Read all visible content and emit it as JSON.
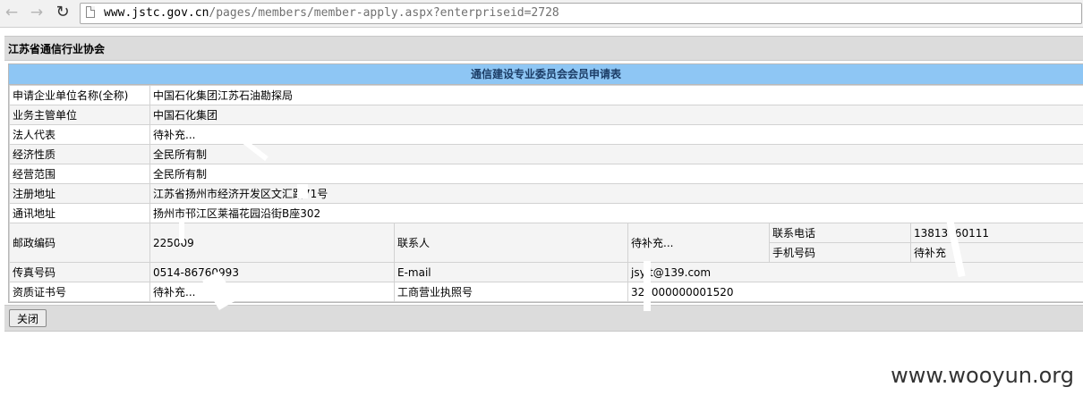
{
  "browser": {
    "url_host": "www.jstc.gov.cn",
    "url_path": "/pages/members/member-apply.aspx?enterpriseid=2728"
  },
  "page": {
    "org_name": "江苏省通信行业协会",
    "form_title": "通信建设专业委员会会员申请表",
    "close_button": "关闭"
  },
  "form": {
    "rows": [
      {
        "label": "申请企业单位名称(全称)",
        "value": "中国石化集团江苏石油勘探局"
      },
      {
        "label": "业务主管单位",
        "value": "中国石化集团"
      },
      {
        "label": "法人代表",
        "value": "待补充..."
      },
      {
        "label": "经济性质",
        "value": "全民所有制"
      },
      {
        "label": "经营范围",
        "value": "全民所有制"
      },
      {
        "label": "注册地址",
        "value": "江苏省扬州市经济开发区文汇路71号"
      },
      {
        "label": "通讯地址",
        "value": "扬州市邗江区莱福花园沿街B座302"
      }
    ],
    "postal_label": "邮政编码",
    "postal_value": "225009",
    "contact_label": "联系人",
    "contact_value": "待补充...",
    "phone_label": "联系电话",
    "phone_value": "13813760111",
    "mobile_label": "手机号码",
    "mobile_value": "待补充",
    "fax_label": "传真号码",
    "fax_value": "0514-86760993",
    "email_label": "E-mail",
    "email_value": "jsyjt@139.com",
    "cert_label": "资质证书号",
    "cert_value": "待补充...",
    "license_label": "工商营业执照号",
    "license_value": "321000000001520"
  },
  "watermark": "www.wooyun.org"
}
